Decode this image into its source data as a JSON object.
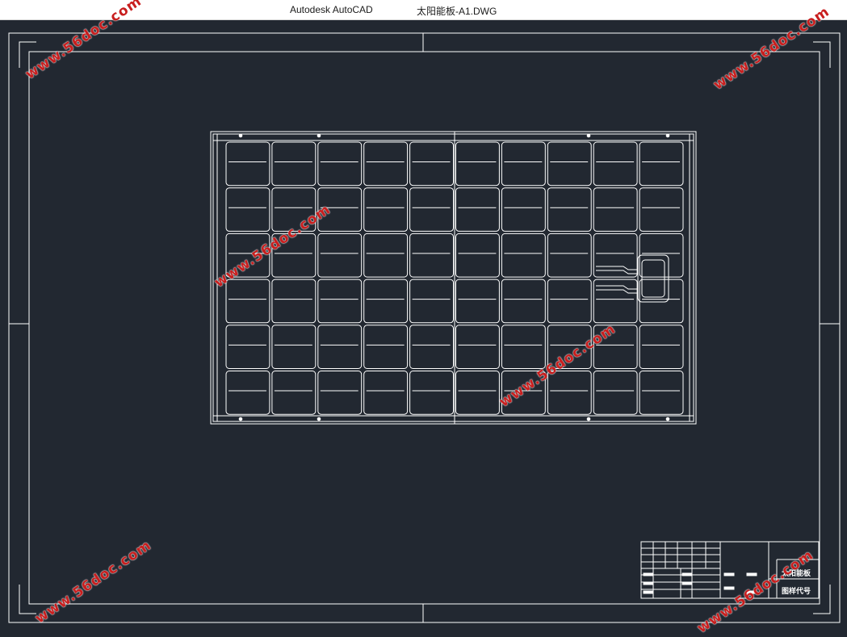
{
  "titlebar": {
    "app_name": "Autodesk AutoCAD",
    "document_name": "太阳能板-A1.DWG"
  },
  "drawing": {
    "title_block": {
      "part_name": "太阳能板",
      "drawing_code_label": "图样代号"
    },
    "panel": {
      "cell_columns": 10,
      "cell_rows": 6
    }
  },
  "watermarks": {
    "text": "www.56doc.com"
  },
  "colors": {
    "background": "#222831",
    "lines": "#ffffff",
    "watermark": "#c81e1e"
  }
}
